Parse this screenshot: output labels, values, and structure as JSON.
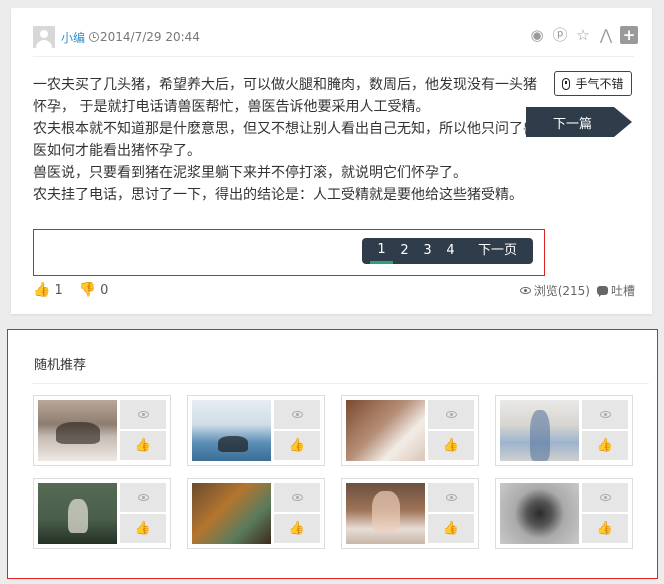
{
  "post": {
    "author": "小编",
    "date": "2014/7/29 20:44",
    "paragraphs": [
      "一农夫买了几头猪，希望养大后，可以做火腿和腌肉，数周后，他发现没有一头猪怀孕， 于是就打电话请兽医帮忙，兽医告诉他要采用人工受精。",
      "农夫根本就不知道那是什麽意思，但又不想让别人看出自己无知，所以他只问了兽医如何才能看出猪怀孕了。",
      "兽医说，只要看到猪在泥浆里躺下来并不停打滚，就说明它们怀孕了。",
      "农夫挂了电话，思讨了一下，得出的结论是：人工受精就是要他给这些猪受精。"
    ],
    "luck_button": "手气不错",
    "next_article": "下一篇",
    "pagination": {
      "pages": [
        "1",
        "2",
        "3",
        "4"
      ],
      "active": "1",
      "next": "下一页"
    },
    "likes": "1",
    "dislikes": "0",
    "views": "浏览(215)",
    "comment": "吐槽",
    "share_icons": [
      "weibo-icon",
      "pinterest-icon",
      "star-icon",
      "renren-icon",
      "plus-icon"
    ]
  },
  "recommend": {
    "title": "随机推荐",
    "items": [
      {
        "thumb": "breakdance-photo"
      },
      {
        "thumb": "screenshot-photo"
      },
      {
        "thumb": "bread-photo"
      },
      {
        "thumb": "woman-jeans-photo"
      },
      {
        "thumb": "guitar-photo"
      },
      {
        "thumb": "hands-photo"
      },
      {
        "thumb": "girl-photo"
      },
      {
        "thumb": "mosquito-coil-photo"
      }
    ]
  },
  "colors": {
    "accent_link": "#3a8fc8",
    "dark_button": "#2f3d4b",
    "pager_active": "#2ea07a",
    "highlight_border": "#dd2222"
  }
}
